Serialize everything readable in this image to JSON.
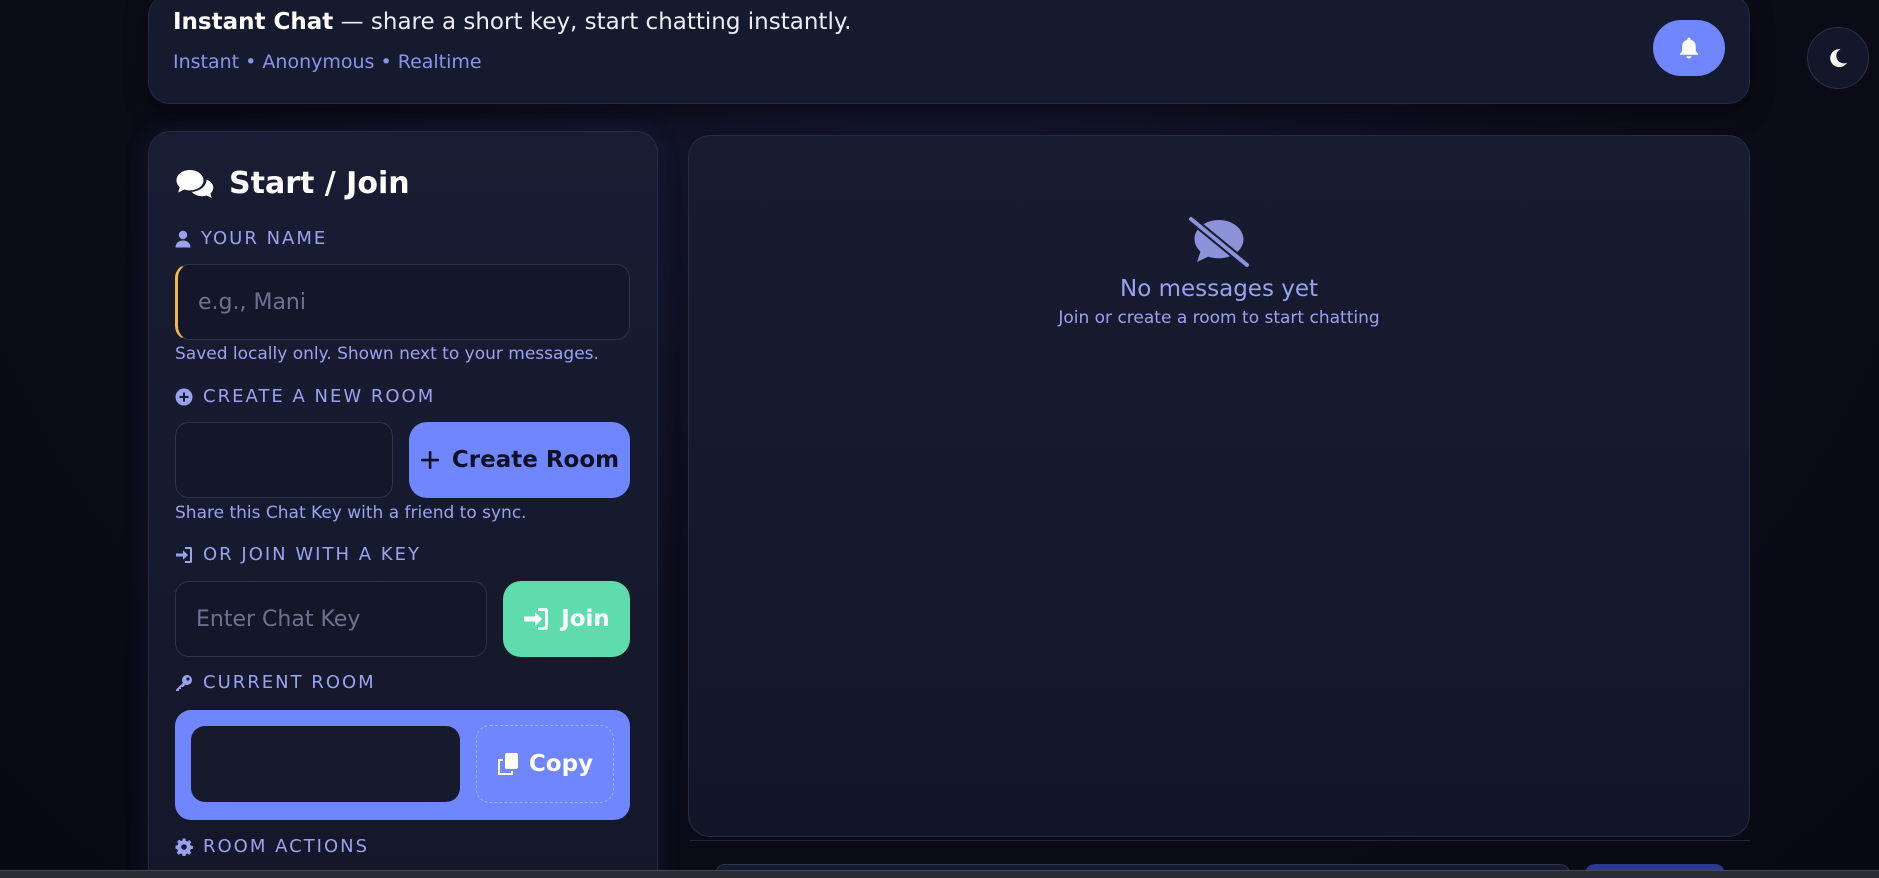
{
  "header": {
    "app_name": "Instant Chat",
    "tagline_rest": " — share a short key, start chatting instantly.",
    "subtitle": "Instant • Anonymous • Realtime",
    "notifications_icon": "bell-icon",
    "theme_icon": "moon-icon"
  },
  "sidebar": {
    "title": "Start / Join",
    "title_icon": "comments-icon",
    "name_section": {
      "label": "YOUR NAME",
      "icon": "user-icon",
      "placeholder": "e.g., Mani",
      "value": "",
      "hint": "Saved locally only. Shown next to your messages."
    },
    "create_section": {
      "label": "CREATE A NEW ROOM",
      "icon": "plus-circle-icon",
      "value": "",
      "button_label": "Create Room",
      "hint": "Share this Chat Key with a friend to sync."
    },
    "join_section": {
      "label": "OR JOIN WITH A KEY",
      "icon": "sign-in-icon",
      "placeholder": "Enter Chat Key",
      "button_label": "Join"
    },
    "current_room": {
      "label": "CURRENT ROOM",
      "icon": "key-icon",
      "value": "",
      "copy_label": "Copy"
    },
    "room_actions": {
      "label": "ROOM ACTIONS",
      "icon": "gear-icon"
    }
  },
  "chat": {
    "empty_icon": "comment-slash-icon",
    "empty_title": "No messages yet",
    "empty_subtitle": "Join or create a room to start chatting"
  },
  "colors": {
    "accent": "#6f86ff",
    "join": "#5fdcae",
    "name_accent": "#f0b94a",
    "label": "#9aa2f0"
  }
}
